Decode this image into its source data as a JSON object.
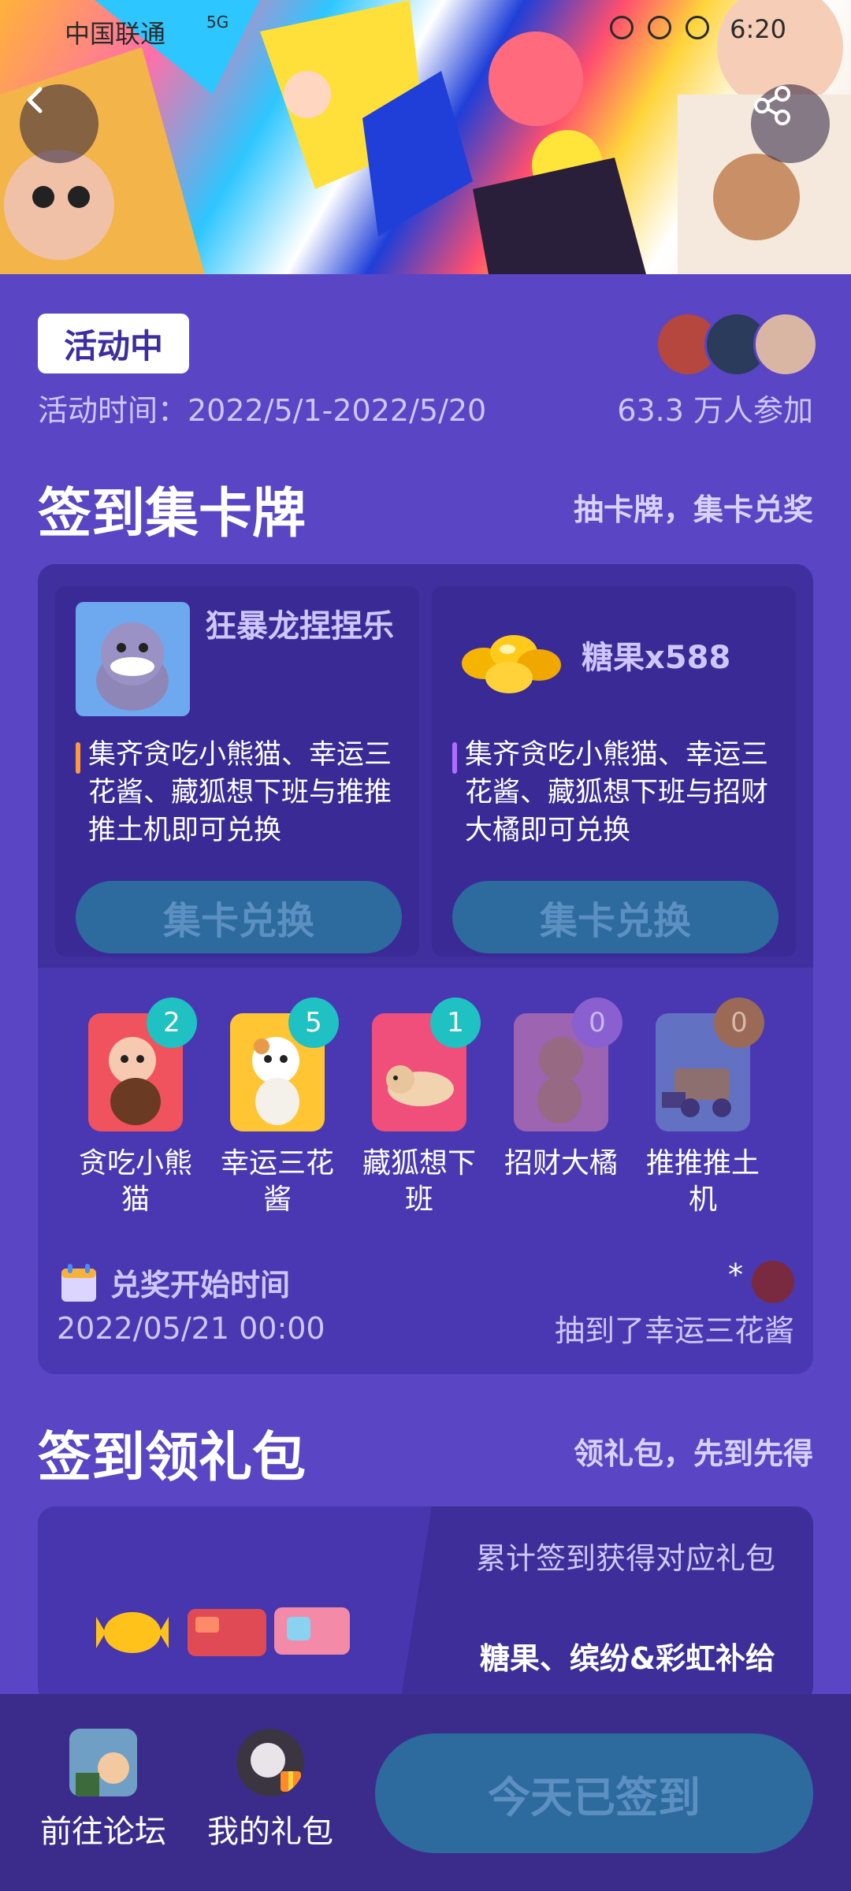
{
  "status_bar": {
    "carrier": "中国联通",
    "network": "5G",
    "time": "6:20"
  },
  "header": {
    "back_icon": "chevron-left-icon",
    "share_icon": "share-icon"
  },
  "activity": {
    "status": "活动中",
    "time": "活动时间：2022/5/1-2022/5/20",
    "participants": "63.3 万人参加"
  },
  "checkin_cards": {
    "title": "签到集卡牌",
    "subtitle": "抽卡牌，集卡兑奖",
    "rewards": [
      {
        "name": "狂暴龙捏捏乐",
        "description": "集齐贪吃小熊猫、幸运三花酱、藏狐想下班与推推推土机即可兑换",
        "button": "集卡兑换",
        "bar_color": "#ff9a3c"
      },
      {
        "name": "糖果x588",
        "description": "集齐贪吃小熊猫、幸运三花酱、藏狐想下班与招财大橘即可兑换",
        "button": "集卡兑换",
        "bar_color": "#b06cff"
      }
    ],
    "cards": [
      {
        "name": "贪吃小熊猫",
        "count": "2",
        "badge_color": "#1fc1c3"
      },
      {
        "name": "幸运三花酱",
        "count": "5",
        "badge_color": "#1fc1c3"
      },
      {
        "name": "藏狐想下班",
        "count": "1",
        "badge_color": "#1fc1c3"
      },
      {
        "name": "招财大橘",
        "count": "0",
        "badge_color": "#8a5fd0"
      },
      {
        "name": "推推推土机",
        "count": "0",
        "badge_color": "#9a6a56"
      }
    ],
    "redeem_label": "兑奖开始时间",
    "redeem_time": "2022/05/21 00:00",
    "ticker_user": "*",
    "ticker_text": "抽到了幸运三花酱"
  },
  "checkin_gifts": {
    "title": "签到领礼包",
    "subtitle": "领礼包，先到先得",
    "desc": "累计签到获得对应礼包",
    "items": "糖果、缤纷&彩虹补给"
  },
  "bottom_bar": {
    "forum": "前往论坛",
    "gifts": "我的礼包",
    "signin": "今天已签到"
  }
}
